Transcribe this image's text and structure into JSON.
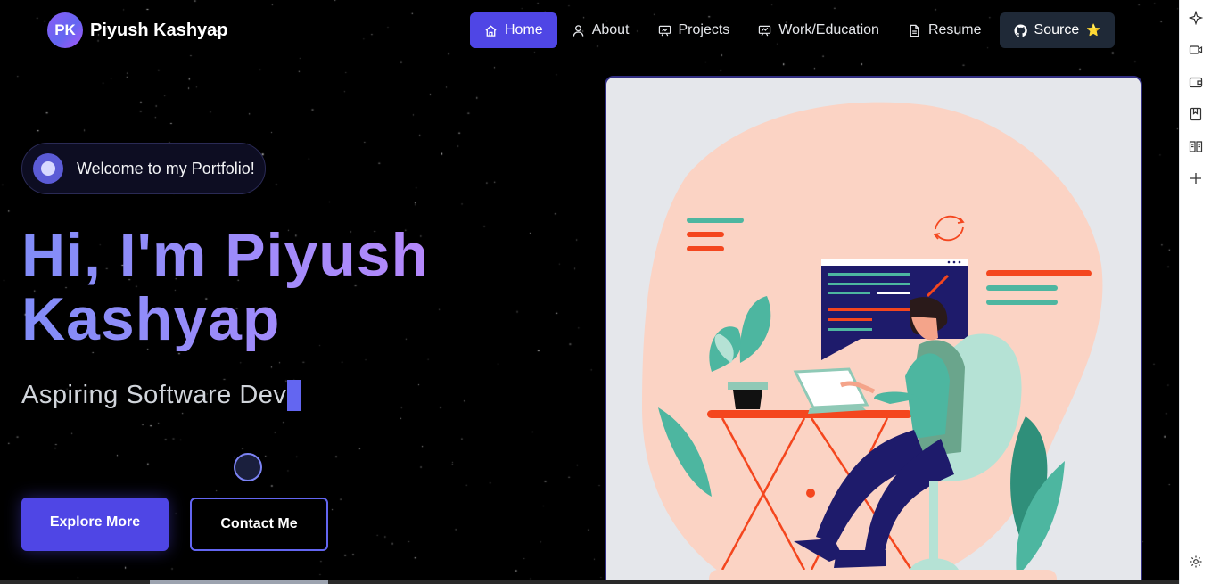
{
  "brand": {
    "initials": "PK",
    "name": "Piyush Kashyap"
  },
  "nav": [
    {
      "label": "Home",
      "icon": "home-icon",
      "active": true
    },
    {
      "label": "About",
      "icon": "user-icon"
    },
    {
      "label": "Projects",
      "icon": "presentation-icon"
    },
    {
      "label": "Work/Education",
      "icon": "presentation-chart-icon"
    },
    {
      "label": "Resume",
      "icon": "document-icon"
    },
    {
      "label": "Source",
      "icon": "github-icon",
      "badge": "⭐"
    }
  ],
  "hero": {
    "welcome": "Welcome to my Portfolio!",
    "title_line1": "Hi, I'm Piyush",
    "title_line2": "Kashyap",
    "subtitle": "Aspiring Software Dev",
    "primary_button": "Explore More",
    "secondary_button": "Contact Me"
  },
  "side_toolbar": [
    "sparkle-icon",
    "video-icon",
    "wallet-icon",
    "bookmark-icon",
    "book-icon",
    "plus-icon",
    "settings-icon"
  ],
  "colors": {
    "accent": "#4f46e5",
    "background": "#000000",
    "title_gradient_start": "#818cf8",
    "title_gradient_end": "#c084fc",
    "peach": "#fbd3c4",
    "teal": "#4db6a0",
    "orange_red": "#f4461e",
    "navy": "#1e1b6b"
  }
}
